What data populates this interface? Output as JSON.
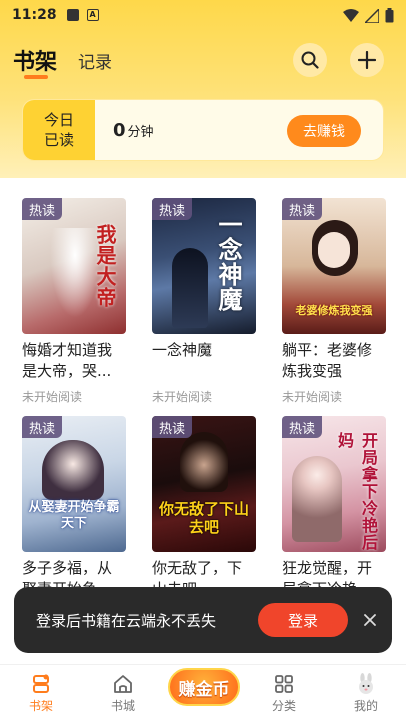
{
  "status_bar": {
    "time": "11:28"
  },
  "header": {
    "shelf_tab": "书架",
    "history_tab": "记录"
  },
  "reading": {
    "badge_line1": "今日",
    "badge_line2": "已读",
    "minutes": "0",
    "unit": "分钟",
    "earn_label": "去赚钱"
  },
  "hot_tag": "热读",
  "books": [
    {
      "title": "悔婚才知道我是大帝，哭...",
      "status": "未开始阅读",
      "cover_text": "我是大帝"
    },
    {
      "title": "一念神魔",
      "status": "未开始阅读",
      "cover_text": "一念神魔"
    },
    {
      "title": "躺平：老婆修炼我变强",
      "status": "未开始阅读",
      "cover_text": "老婆修炼我变强"
    },
    {
      "title": "多子多福，从娶妻开始争...",
      "status": "",
      "cover_text": "从娶妻开始争霸天下"
    },
    {
      "title": "你无敌了，下山去吧",
      "status": "",
      "cover_text": "你无敌了下山去吧"
    },
    {
      "title": "狂龙觉醒，开局拿下冷艳...",
      "status": "",
      "cover_text": "开局拿下冷艳后妈"
    }
  ],
  "toast": {
    "text": "登录后书籍在云端永不丢失",
    "login_label": "登录"
  },
  "nav": {
    "shelf": "书架",
    "store": "书城",
    "earn": "赚金币",
    "category": "分类",
    "mine": "我的"
  },
  "colors": {
    "accent": "#ff7d1d",
    "header_yellow": "#fed84a",
    "login_red": "#f0452b"
  }
}
